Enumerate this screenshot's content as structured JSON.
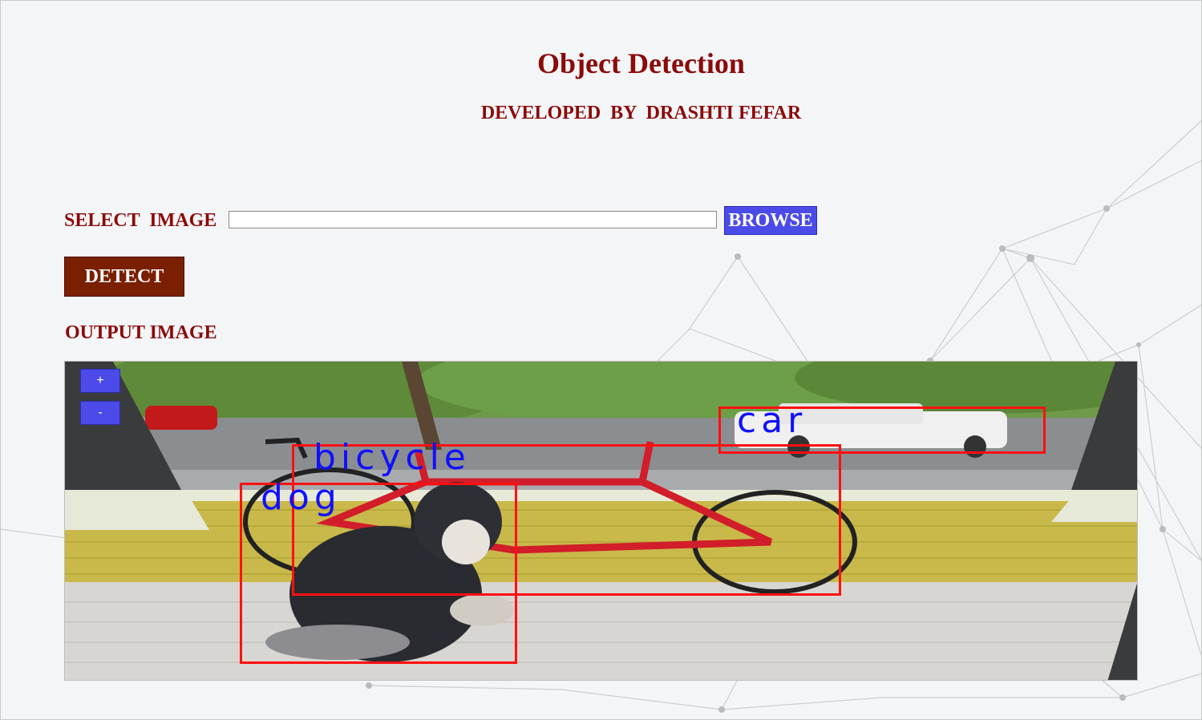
{
  "header": {
    "title": "Object Detection",
    "subtitle": "DEVELOPED  BY  DRASHTI FEFAR"
  },
  "form": {
    "select_label": "SELECT  IMAGE",
    "path_value": "",
    "browse_label": "BROWSE",
    "detect_label": "DETECT"
  },
  "output": {
    "label": "OUTPUT IMAGE",
    "zoom_in_label": "+",
    "zoom_out_label": "-",
    "detections": [
      {
        "label": "car"
      },
      {
        "label": "bicycle"
      },
      {
        "label": "dog"
      }
    ]
  },
  "colors": {
    "title": "#8b0a0a",
    "browse_button": "#4b4bea",
    "detect_button": "#7a2000",
    "detection_box": "#ff1010",
    "detection_label": "#1010ff"
  }
}
